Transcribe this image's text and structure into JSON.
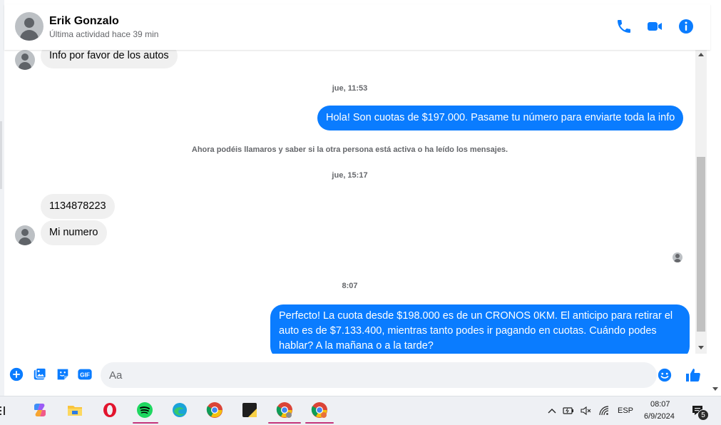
{
  "header": {
    "name": "Erik Gonzalo",
    "status": "Última actividad hace 39 min"
  },
  "messages": {
    "first_incoming": "Info por favor de los autos",
    "timestamp_1": "jue, 11:53",
    "outgoing_1": "Hola! Son cuotas de $197.000. Pasame tu número para enviarte toda la info",
    "system_note": "Ahora podéis llamaros y saber si la otra persona está activa o ha leído los mensajes.",
    "timestamp_2": "jue, 15:17",
    "incoming_2": "1134878223",
    "incoming_3": "Mi numero",
    "timestamp_3": "8:07",
    "outgoing_2": "Perfecto! La cuota desde $198.000 es de un CRONOS 0KM. El anticipo para retirar el auto es de $7.133.400, mientras tanto podes ir pagando en cuotas. Cuándo podes hablar? A la mañana o a la tarde?"
  },
  "composer": {
    "placeholder": "Aa"
  },
  "taskbar": {
    "language": "ESP",
    "time": "08:07",
    "date": "6/9/2024",
    "notification_count": "5"
  },
  "colors": {
    "messenger_blue": "#0a7cff",
    "incoming_bubble": "#f0f0f0",
    "muted_text": "#65676b"
  }
}
